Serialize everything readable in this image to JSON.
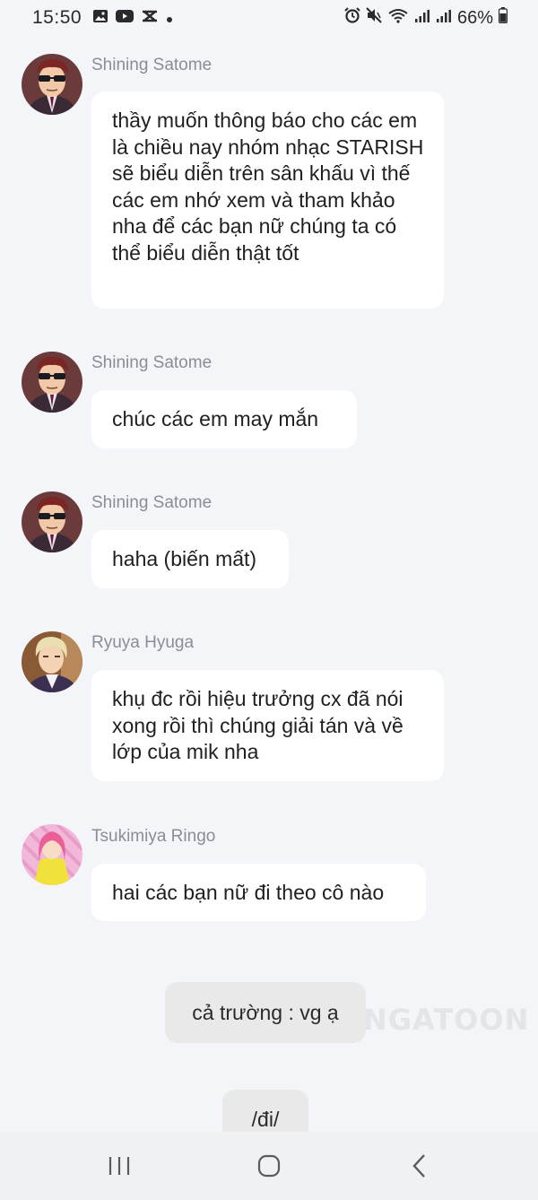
{
  "status_bar": {
    "time": "15:50",
    "battery": "66%",
    "left_icons": [
      "image-icon",
      "youtube-icon",
      "capcut-icon",
      "dot-icon"
    ],
    "right_icons": [
      "alarm-icon",
      "mute-icon",
      "wifi-icon",
      "signal-icon",
      "signal-icon",
      "battery-icon"
    ]
  },
  "messages": [
    {
      "sender": "Shining Satome",
      "avatar": "shining-satome-avatar",
      "text": "thầy muốn thông báo cho các em là chiều nay nhóm nhạc STARISH sẽ biểu diễn trên sân khấu vì thế các em nhớ xem và tham khảo nha để các bạn nữ chúng ta có thể biểu diễn thật tốt"
    },
    {
      "sender": "Shining Satome",
      "avatar": "shining-satome-avatar",
      "text": "chúc các em may mắn"
    },
    {
      "sender": "Shining Satome",
      "avatar": "shining-satome-avatar",
      "text": "haha (biến mất)"
    },
    {
      "sender": "Ryuya Hyuga",
      "avatar": "ryuya-hyuga-avatar",
      "text": "khụ đc rồi hiệu trưởng cx đã nói xong rồi thì chúng giải tán và về lớp của mik nha"
    },
    {
      "sender": "Tsukimiya Ringo",
      "avatar": "tsukimiya-ringo-avatar",
      "text": "hai các bạn nữ đi theo cô nào"
    }
  ],
  "narration": [
    {
      "text": "cả trường : vg ạ"
    },
    {
      "text": "/đi/"
    }
  ],
  "watermark": "NGATOON",
  "colors": {
    "background": "#f4f5f8",
    "bubble": "#ffffff",
    "narration_bubble": "#e9e9ea",
    "sender_name": "#8b8d93"
  }
}
